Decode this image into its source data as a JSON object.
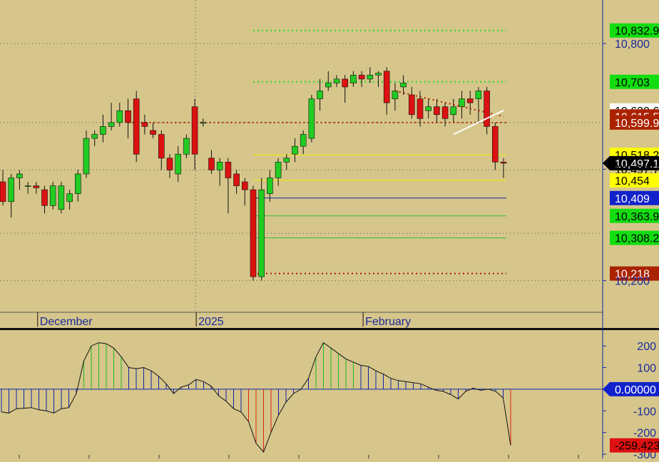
{
  "chart_data": [
    {
      "type": "candlestick",
      "x_labels": [
        {
          "label": "December",
          "at": 4
        },
        {
          "label": "2025",
          "at": 23
        },
        {
          "label": "February",
          "at": 43
        }
      ],
      "y_ticks": [
        "10,800",
        "10,200"
      ],
      "y_tick_values": [
        10800,
        10200
      ],
      "ylim": [
        10120,
        10910
      ],
      "grid": "dotted",
      "candles": [
        [
          10450,
          10480,
          10390,
          10400
        ],
        [
          10400,
          10470,
          10360,
          10460
        ],
        [
          10460,
          10480,
          10430,
          10470
        ],
        [
          10440,
          10450,
          10420,
          10440
        ],
        [
          10440,
          10450,
          10420,
          10435
        ],
        [
          10430,
          10440,
          10370,
          10390
        ],
        [
          10390,
          10450,
          10380,
          10440
        ],
        [
          10380,
          10450,
          10370,
          10440
        ],
        [
          10400,
          10430,
          10380,
          10420
        ],
        [
          10420,
          10480,
          10400,
          10470
        ],
        [
          10470,
          10580,
          10460,
          10560
        ],
        [
          10560,
          10580,
          10540,
          10570
        ],
        [
          10570,
          10620,
          10550,
          10590
        ],
        [
          10590,
          10650,
          10580,
          10600
        ],
        [
          10600,
          10650,
          10590,
          10630
        ],
        [
          10630,
          10660,
          10560,
          10600
        ],
        [
          10660,
          10680,
          10500,
          10520
        ],
        [
          10600,
          10620,
          10570,
          10590
        ],
        [
          10580,
          10600,
          10560,
          10570
        ],
        [
          10570,
          10580,
          10480,
          10510
        ],
        [
          10510,
          10520,
          10460,
          10480
        ],
        [
          10470,
          10540,
          10450,
          10520
        ],
        [
          10520,
          10570,
          10510,
          10560
        ],
        [
          10640,
          10660,
          10480,
          10520
        ],
        [
          10600,
          10610,
          10590,
          10600
        ],
        [
          10510,
          10530,
          10470,
          10480
        ],
        [
          10480,
          10510,
          10440,
          10500
        ],
        [
          10500,
          10510,
          10370,
          10460
        ],
        [
          10470,
          10480,
          10420,
          10440
        ],
        [
          10450,
          10460,
          10390,
          10430
        ],
        [
          10430,
          10440,
          10200,
          10210
        ],
        [
          10210,
          10460,
          10200,
          10430
        ],
        [
          10420,
          10480,
          10400,
          10460
        ],
        [
          10460,
          10510,
          10440,
          10500
        ],
        [
          10500,
          10520,
          10480,
          10510
        ],
        [
          10520,
          10560,
          10500,
          10540
        ],
        [
          10540,
          10580,
          10520,
          10570
        ],
        [
          10560,
          10670,
          10550,
          10660
        ],
        [
          10660,
          10710,
          10630,
          10680
        ],
        [
          10690,
          10730,
          10680,
          10700
        ],
        [
          10700,
          10720,
          10690,
          10710
        ],
        [
          10710,
          10720,
          10650,
          10690
        ],
        [
          10700,
          10730,
          10690,
          10720
        ],
        [
          10720,
          10730,
          10690,
          10710
        ],
        [
          10710,
          10740,
          10700,
          10720
        ],
        [
          10720,
          10730,
          10690,
          10725
        ],
        [
          10730,
          10740,
          10620,
          10650
        ],
        [
          10660,
          10700,
          10630,
          10680
        ],
        [
          10690,
          10720,
          10670,
          10700
        ],
        [
          10670,
          10690,
          10610,
          10620
        ],
        [
          10660,
          10680,
          10590,
          10610
        ],
        [
          10630,
          10660,
          10610,
          10640
        ],
        [
          10640,
          10660,
          10600,
          10620
        ],
        [
          10640,
          10650,
          10590,
          10610
        ],
        [
          10620,
          10660,
          10600,
          10640
        ],
        [
          10640,
          10680,
          10610,
          10660
        ],
        [
          10660,
          10680,
          10620,
          10650
        ],
        [
          10660,
          10690,
          10600,
          10680
        ],
        [
          10680,
          10690,
          10570,
          10590
        ],
        [
          10590,
          10600,
          10480,
          10500
        ],
        [
          10500,
          10510,
          10460,
          10497.1
        ]
      ],
      "overlay_lines": [
        {
          "color": "#22dd22",
          "style": "dotted",
          "value": 10832.9,
          "from": 30,
          "to": 60
        },
        {
          "color": "#22dd22",
          "style": "dotted",
          "value": 10703,
          "from": 30,
          "to": 60
        },
        {
          "color": "#aa2200",
          "style": "dotted",
          "value": 10599.9,
          "from": 15,
          "to": 60
        },
        {
          "color": "#aa2200",
          "style": "dotted",
          "value": 10218,
          "from": 30,
          "to": 60
        },
        {
          "color": "#eeee00",
          "style": "solid",
          "value": 10518.2,
          "from": 30,
          "to": 60
        },
        {
          "color": "#eeee00",
          "style": "solid",
          "value": 10454,
          "from": 30,
          "to": 60
        },
        {
          "color": "#1122aa",
          "style": "solid",
          "value": 10409,
          "from": 30,
          "to": 60
        },
        {
          "color": "#33bb33",
          "style": "solid",
          "value": 10363.9,
          "from": 30,
          "to": 60
        },
        {
          "color": "#33bb33",
          "style": "solid",
          "value": 10308.2,
          "from": 30,
          "to": 60
        }
      ],
      "trend_lines": [
        {
          "color": "#aa2200",
          "style": "dotted",
          "from": [
            47,
            10680
          ],
          "to": [
            60,
            10615.5
          ]
        },
        {
          "color": "#ffffff",
          "style": "solid",
          "from": [
            54,
            10570
          ],
          "to": [
            60,
            10630.6
          ]
        }
      ],
      "price_labels": [
        {
          "text": "10,832.9",
          "value": 10832.9,
          "bg": "#11dd11",
          "fg": "#000000"
        },
        {
          "text": "10,800",
          "value": 10800,
          "bg": "",
          "fg": "#1a2a9a"
        },
        {
          "text": "10,703",
          "value": 10703,
          "bg": "#11dd11",
          "fg": "#000000"
        },
        {
          "text": "10,630.6",
          "value": 10630.6,
          "bg": "#ffffff",
          "fg": "#000000"
        },
        {
          "text": "10,615.5",
          "value": 10615.5,
          "bg": "#aa2200",
          "fg": "#ffffff"
        },
        {
          "text": "10,599.9",
          "value": 10599.9,
          "bg": "#aa2200",
          "fg": "#ffffff"
        },
        {
          "text": "10,518.2",
          "value": 10518.2,
          "bg": "#ffff00",
          "fg": "#000000"
        },
        {
          "text": "10,497.1",
          "value": 10497.1,
          "bg": "#000000",
          "fg": "#ffffff",
          "arrow": true
        },
        {
          "text": "10,497.7",
          "value": 10482,
          "bg": "",
          "fg": "#000000"
        },
        {
          "text": "10,454",
          "value": 10454,
          "bg": "#ffff00",
          "fg": "#000000"
        },
        {
          "text": "10,409",
          "value": 10409,
          "bg": "#1122cc",
          "fg": "#ffffff"
        },
        {
          "text": "10,363.9",
          "value": 10363.9,
          "bg": "#11dd11",
          "fg": "#000000"
        },
        {
          "text": "10,308.2",
          "value": 10308.2,
          "bg": "#11dd11",
          "fg": "#000000"
        },
        {
          "text": "10,218",
          "value": 10218,
          "bg": "#aa2200",
          "fg": "#ffffff"
        },
        {
          "text": "10,200",
          "value": 10200,
          "bg": "",
          "fg": "#1a2a9a"
        }
      ]
    },
    {
      "type": "histogram",
      "y_ticks": [
        "200",
        "100",
        "-100",
        "-200",
        "-300"
      ],
      "y_tick_values": [
        200,
        100,
        -100,
        -200,
        -300
      ],
      "ylim": [
        -300,
        250
      ],
      "values": [
        -105,
        -110,
        -90,
        -88,
        -85,
        -95,
        -100,
        -110,
        -90,
        -85,
        -20,
        130,
        200,
        215,
        210,
        190,
        150,
        100,
        95,
        100,
        85,
        60,
        25,
        -20,
        10,
        20,
        45,
        35,
        15,
        -30,
        -55,
        -90,
        -105,
        -150,
        -250,
        -290,
        -200,
        -120,
        -60,
        -20,
        0,
        50,
        150,
        215,
        190,
        165,
        140,
        125,
        110,
        105,
        85,
        70,
        50,
        40,
        35,
        30,
        25,
        10,
        -5,
        -10,
        -25,
        -45,
        -10,
        5,
        -5,
        0,
        -10,
        -40,
        -259.4231
      ],
      "value_labels": [
        {
          "text": "0.00000",
          "value": 0,
          "bg": "#1122cc",
          "fg": "#ffffff",
          "arrow": true
        },
        {
          "text": "-259.4231",
          "value": -259.4231,
          "bg": "#dd1111",
          "fg": "#000000"
        }
      ]
    }
  ]
}
